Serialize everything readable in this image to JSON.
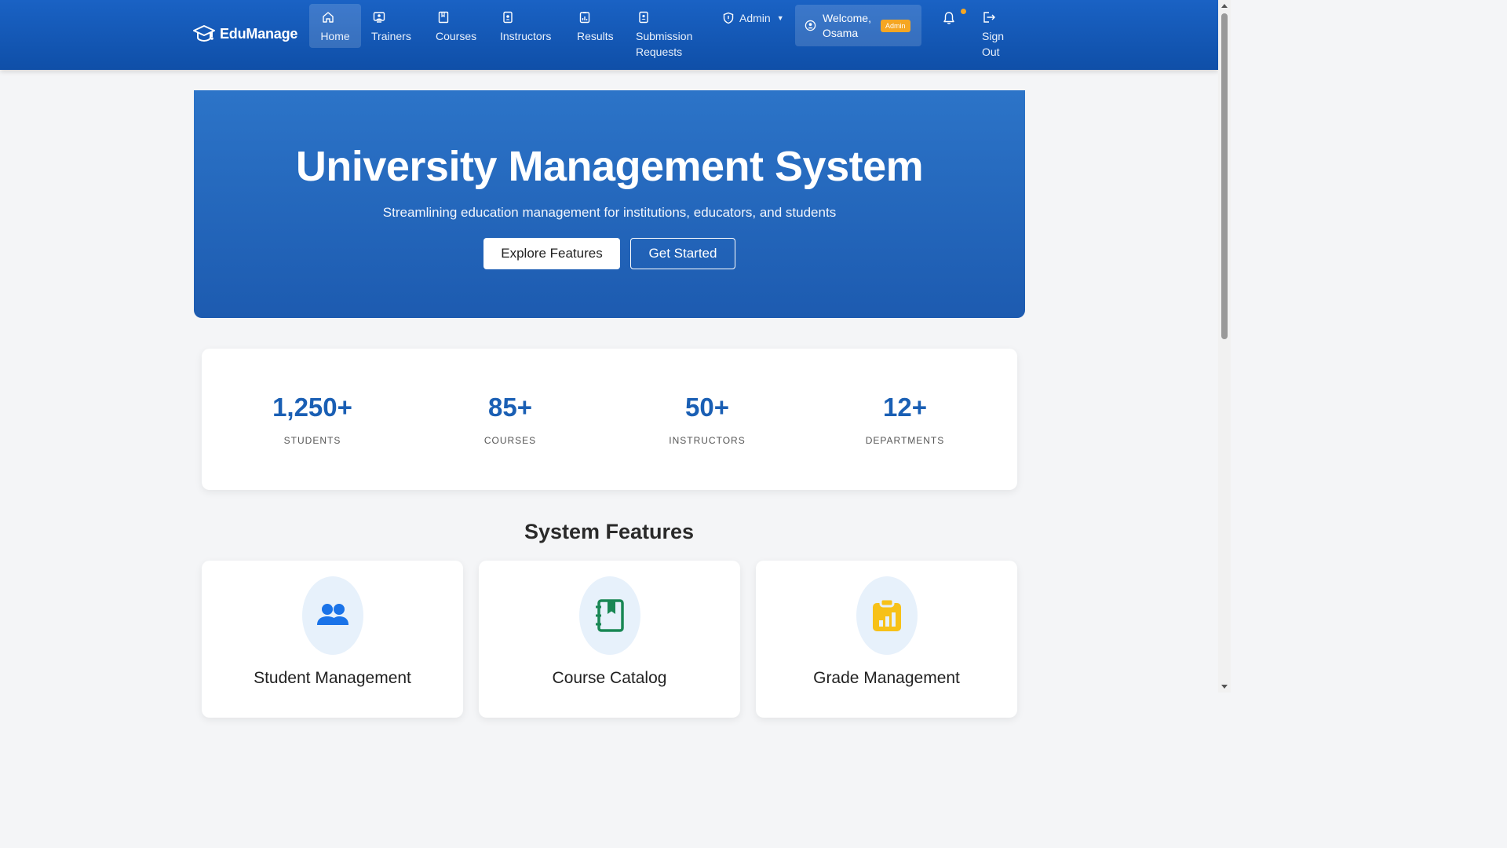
{
  "nav": {
    "brand": "EduManage",
    "items": [
      {
        "label": "Home",
        "icon": "home-icon"
      },
      {
        "label": "Trainers",
        "icon": "trainer-icon"
      },
      {
        "label": "Courses",
        "icon": "book-icon"
      },
      {
        "label": "Instructors",
        "icon": "id-badge-icon"
      },
      {
        "label": "Results",
        "icon": "report-icon"
      },
      {
        "label": "Submission Requests",
        "icon": "clipboard-icon"
      }
    ],
    "admin_label": "Admin",
    "welcome_line1": "Welcome,",
    "welcome_line2": "Osama",
    "role_badge": "Admin",
    "signout_line1": "Sign",
    "signout_line2": "Out"
  },
  "hero": {
    "title": "University Management System",
    "subtitle": "Streamlining education management for institutions, educators, and students",
    "primary_button": "Explore Features",
    "secondary_button": "Get Started"
  },
  "stats": [
    {
      "value": "1,250+",
      "label": "STUDENTS"
    },
    {
      "value": "85+",
      "label": "COURSES"
    },
    {
      "value": "50+",
      "label": "INSTRUCTORS"
    },
    {
      "value": "12+",
      "label": "DEPARTMENTS"
    }
  ],
  "features": {
    "title": "System Features",
    "cards": [
      {
        "title": "Student Management",
        "icon": "users-icon",
        "color": "#1a73e8"
      },
      {
        "title": "Course Catalog",
        "icon": "journal-icon",
        "color": "#198754"
      },
      {
        "title": "Grade Management",
        "icon": "clipboard-chart-icon",
        "color": "#f7c118"
      }
    ]
  },
  "colors": {
    "primary": "#1a5fb4",
    "accent": "#f5a623"
  }
}
